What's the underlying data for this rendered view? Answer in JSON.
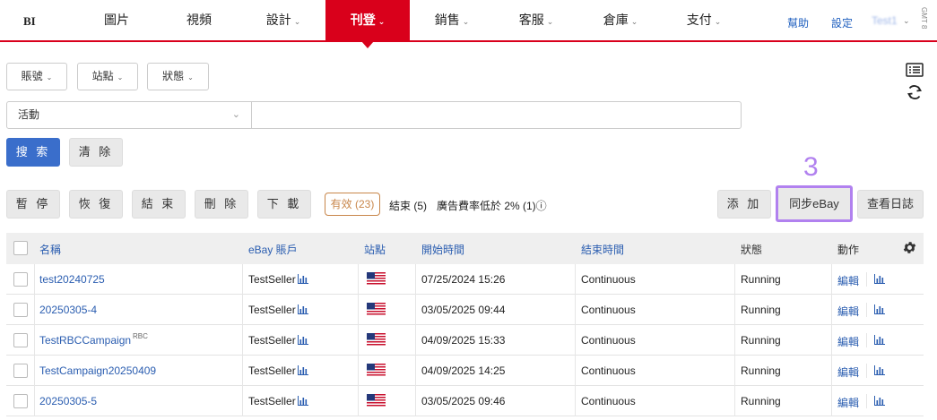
{
  "nav": {
    "logo": "BI",
    "items": [
      "圖片",
      "視頻",
      "設計",
      "刊登",
      "銷售",
      "客服",
      "倉庫",
      "支付"
    ],
    "help": "幫助",
    "settings": "設定",
    "user": "Test1",
    "timezone": "GMT 8"
  },
  "filters": {
    "account": "賬號",
    "site": "站點",
    "status": "狀態",
    "activity_select": "活動",
    "search_value": ""
  },
  "buttons": {
    "search": "搜 索",
    "clear": "清 除",
    "pause": "暫 停",
    "resume": "恢 復",
    "end": "結 束",
    "delete": "刪 除",
    "download": "下 載",
    "add": "添 加",
    "sync": "同步eBay",
    "log": "查看日誌"
  },
  "annotation": "3",
  "stats": {
    "valid": "有效 (23)",
    "ended": "結束 (5)",
    "low_rate": "廣告費率低於 2% (1)ⓘ"
  },
  "table": {
    "headers": {
      "name": "名稱",
      "account": "eBay 賬戶",
      "site": "站點",
      "start": "開始時間",
      "end": "結束時間",
      "status": "狀態",
      "action": "動作"
    },
    "rows": [
      {
        "name": "test20240725",
        "tag": "",
        "account": "TestSeller",
        "start": "07/25/2024 15:26",
        "end": "Continuous",
        "status": "Running",
        "edit": "編輯"
      },
      {
        "name": "20250305-4",
        "tag": "",
        "account": "TestSeller",
        "start": "03/05/2025 09:44",
        "end": "Continuous",
        "status": "Running",
        "edit": "編輯"
      },
      {
        "name": "TestRBCCampaign",
        "tag": "RBC",
        "account": "TestSeller",
        "start": "04/09/2025 15:33",
        "end": "Continuous",
        "status": "Running",
        "edit": "編輯"
      },
      {
        "name": "TestCampaign20250409",
        "tag": "",
        "account": "TestSeller",
        "start": "04/09/2025 14:25",
        "end": "Continuous",
        "status": "Running",
        "edit": "編輯"
      },
      {
        "name": "20250305-5",
        "tag": "",
        "account": "TestSeller",
        "start": "03/05/2025 09:46",
        "end": "Continuous",
        "status": "Running",
        "edit": "編輯"
      }
    ]
  },
  "colors": {
    "brand": "#d9001b",
    "primary": "#3a6ecb",
    "link": "#2a5db0",
    "highlight": "#b181ef",
    "badge": "#c8864a"
  }
}
